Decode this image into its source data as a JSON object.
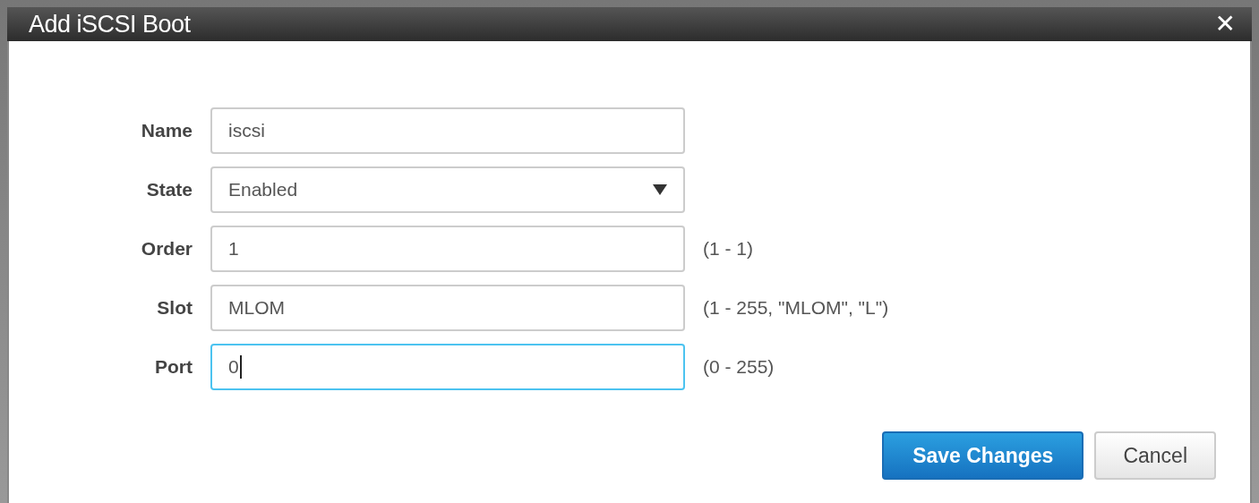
{
  "window": {
    "title": "Add iSCSI Boot",
    "close": "✕"
  },
  "fields": [
    {
      "label": "Name",
      "kind": "text",
      "value": "iscsi",
      "focused": false
    },
    {
      "label": "State",
      "kind": "select",
      "value": "Enabled",
      "focused": false
    },
    {
      "label": "Order",
      "kind": "text",
      "value": "1",
      "hint": "(1 - 1)",
      "focused": false
    },
    {
      "label": "Slot",
      "kind": "text",
      "value": "MLOM",
      "hint": "(1 - 255, \"MLOM\", \"L\")",
      "focused": false
    },
    {
      "label": "Port",
      "kind": "text",
      "value": "0",
      "hint": "(0 - 255)",
      "focused": true
    }
  ],
  "buttons": [
    {
      "label": "Save Changes",
      "kind": "primary"
    },
    {
      "label": "Cancel",
      "kind": "secondary"
    }
  ]
}
